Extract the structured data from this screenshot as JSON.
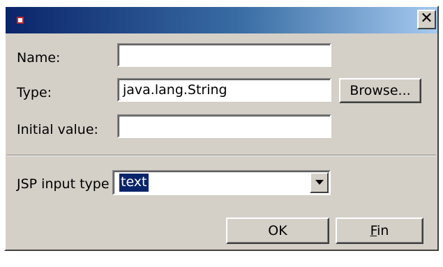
{
  "window": {
    "title": "",
    "icon": "app-icon",
    "close_glyph": "✕",
    "title_gradient": [
      "#0a246a",
      "#a6caf0"
    ]
  },
  "form": {
    "name_label": "Name:",
    "name_value": "",
    "type_label": "Type:",
    "type_value": "java.lang.String",
    "browse_label": "Browse...",
    "initial_label": "Initial value:",
    "initial_value": "",
    "jsp_label": "JSP input type",
    "jsp_selected": "text"
  },
  "buttons": {
    "ok_label": "OK",
    "fin_prefix": "",
    "fin_mnemonic": "F",
    "fin_rest": "in"
  },
  "colors": {
    "dialog_bg": "#d4d0c8",
    "selection": "#0a246a"
  }
}
